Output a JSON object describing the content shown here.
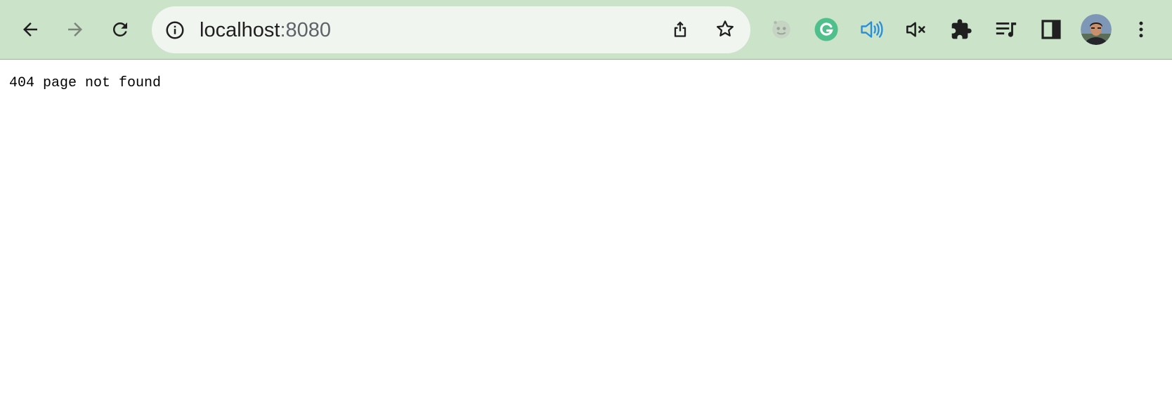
{
  "browser": {
    "address_bar": {
      "host": "localhost",
      "port": ":8080"
    },
    "icons": {
      "back": "back-arrow-icon",
      "forward": "forward-arrow-icon",
      "reload": "reload-icon",
      "site_info": "info-icon",
      "share": "share-icon",
      "bookmark": "star-icon",
      "ext1": "ghost-extension-icon",
      "grammarly": "grammarly-icon",
      "read_aloud": "speaker-icon",
      "mute": "mute-tab-icon",
      "extensions": "puzzle-icon",
      "media": "media-control-icon",
      "side_panel": "side-panel-icon",
      "profile": "avatar",
      "menu": "kebab-menu-icon"
    },
    "colors": {
      "toolbar_bg": "#cbe3c9",
      "omnibox_bg": "#f0f6ef",
      "grammarly": "#15c39a",
      "read_aloud": "#2b8fd8"
    }
  },
  "page": {
    "body_text": "404 page not found"
  }
}
